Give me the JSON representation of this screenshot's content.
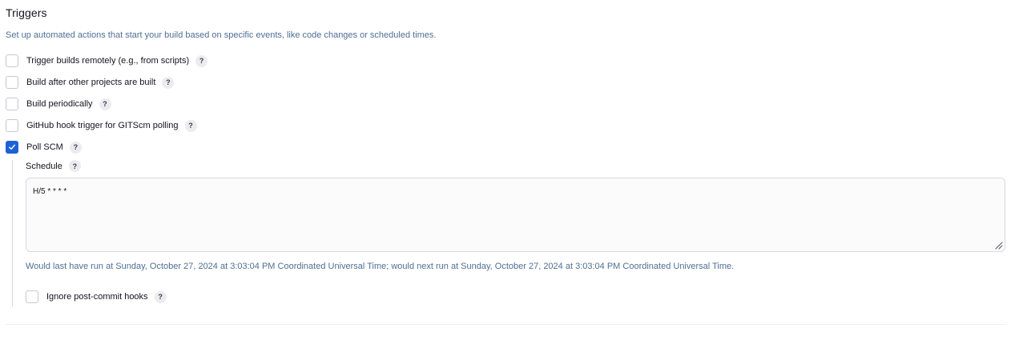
{
  "section": {
    "title": "Triggers",
    "description": "Set up automated actions that start your build based on specific events, like code changes or scheduled times."
  },
  "options": [
    {
      "label": "Trigger builds remotely (e.g., from scripts)",
      "checked": false
    },
    {
      "label": "Build after other projects are built",
      "checked": false
    },
    {
      "label": "Build periodically",
      "checked": false
    },
    {
      "label": "GitHub hook trigger for GITScm polling",
      "checked": false
    },
    {
      "label": "Poll SCM",
      "checked": true
    }
  ],
  "poll_scm": {
    "schedule_label": "Schedule",
    "schedule_value": "H/5 * * * *",
    "run_info": "Would last have run at Sunday, October 27, 2024 at 3:03:04 PM Coordinated Universal Time; would next run at Sunday, October 27, 2024 at 3:03:04 PM Coordinated Universal Time.",
    "ignore_hooks": {
      "label": "Ignore post-commit hooks",
      "checked": false
    }
  },
  "help_glyph": "?",
  "colors": {
    "accent": "#1d62d5",
    "muted_text": "#4f6f94"
  },
  "icons": {
    "check": "check-icon",
    "help": "help-icon",
    "resize": "resize-grip-icon"
  }
}
